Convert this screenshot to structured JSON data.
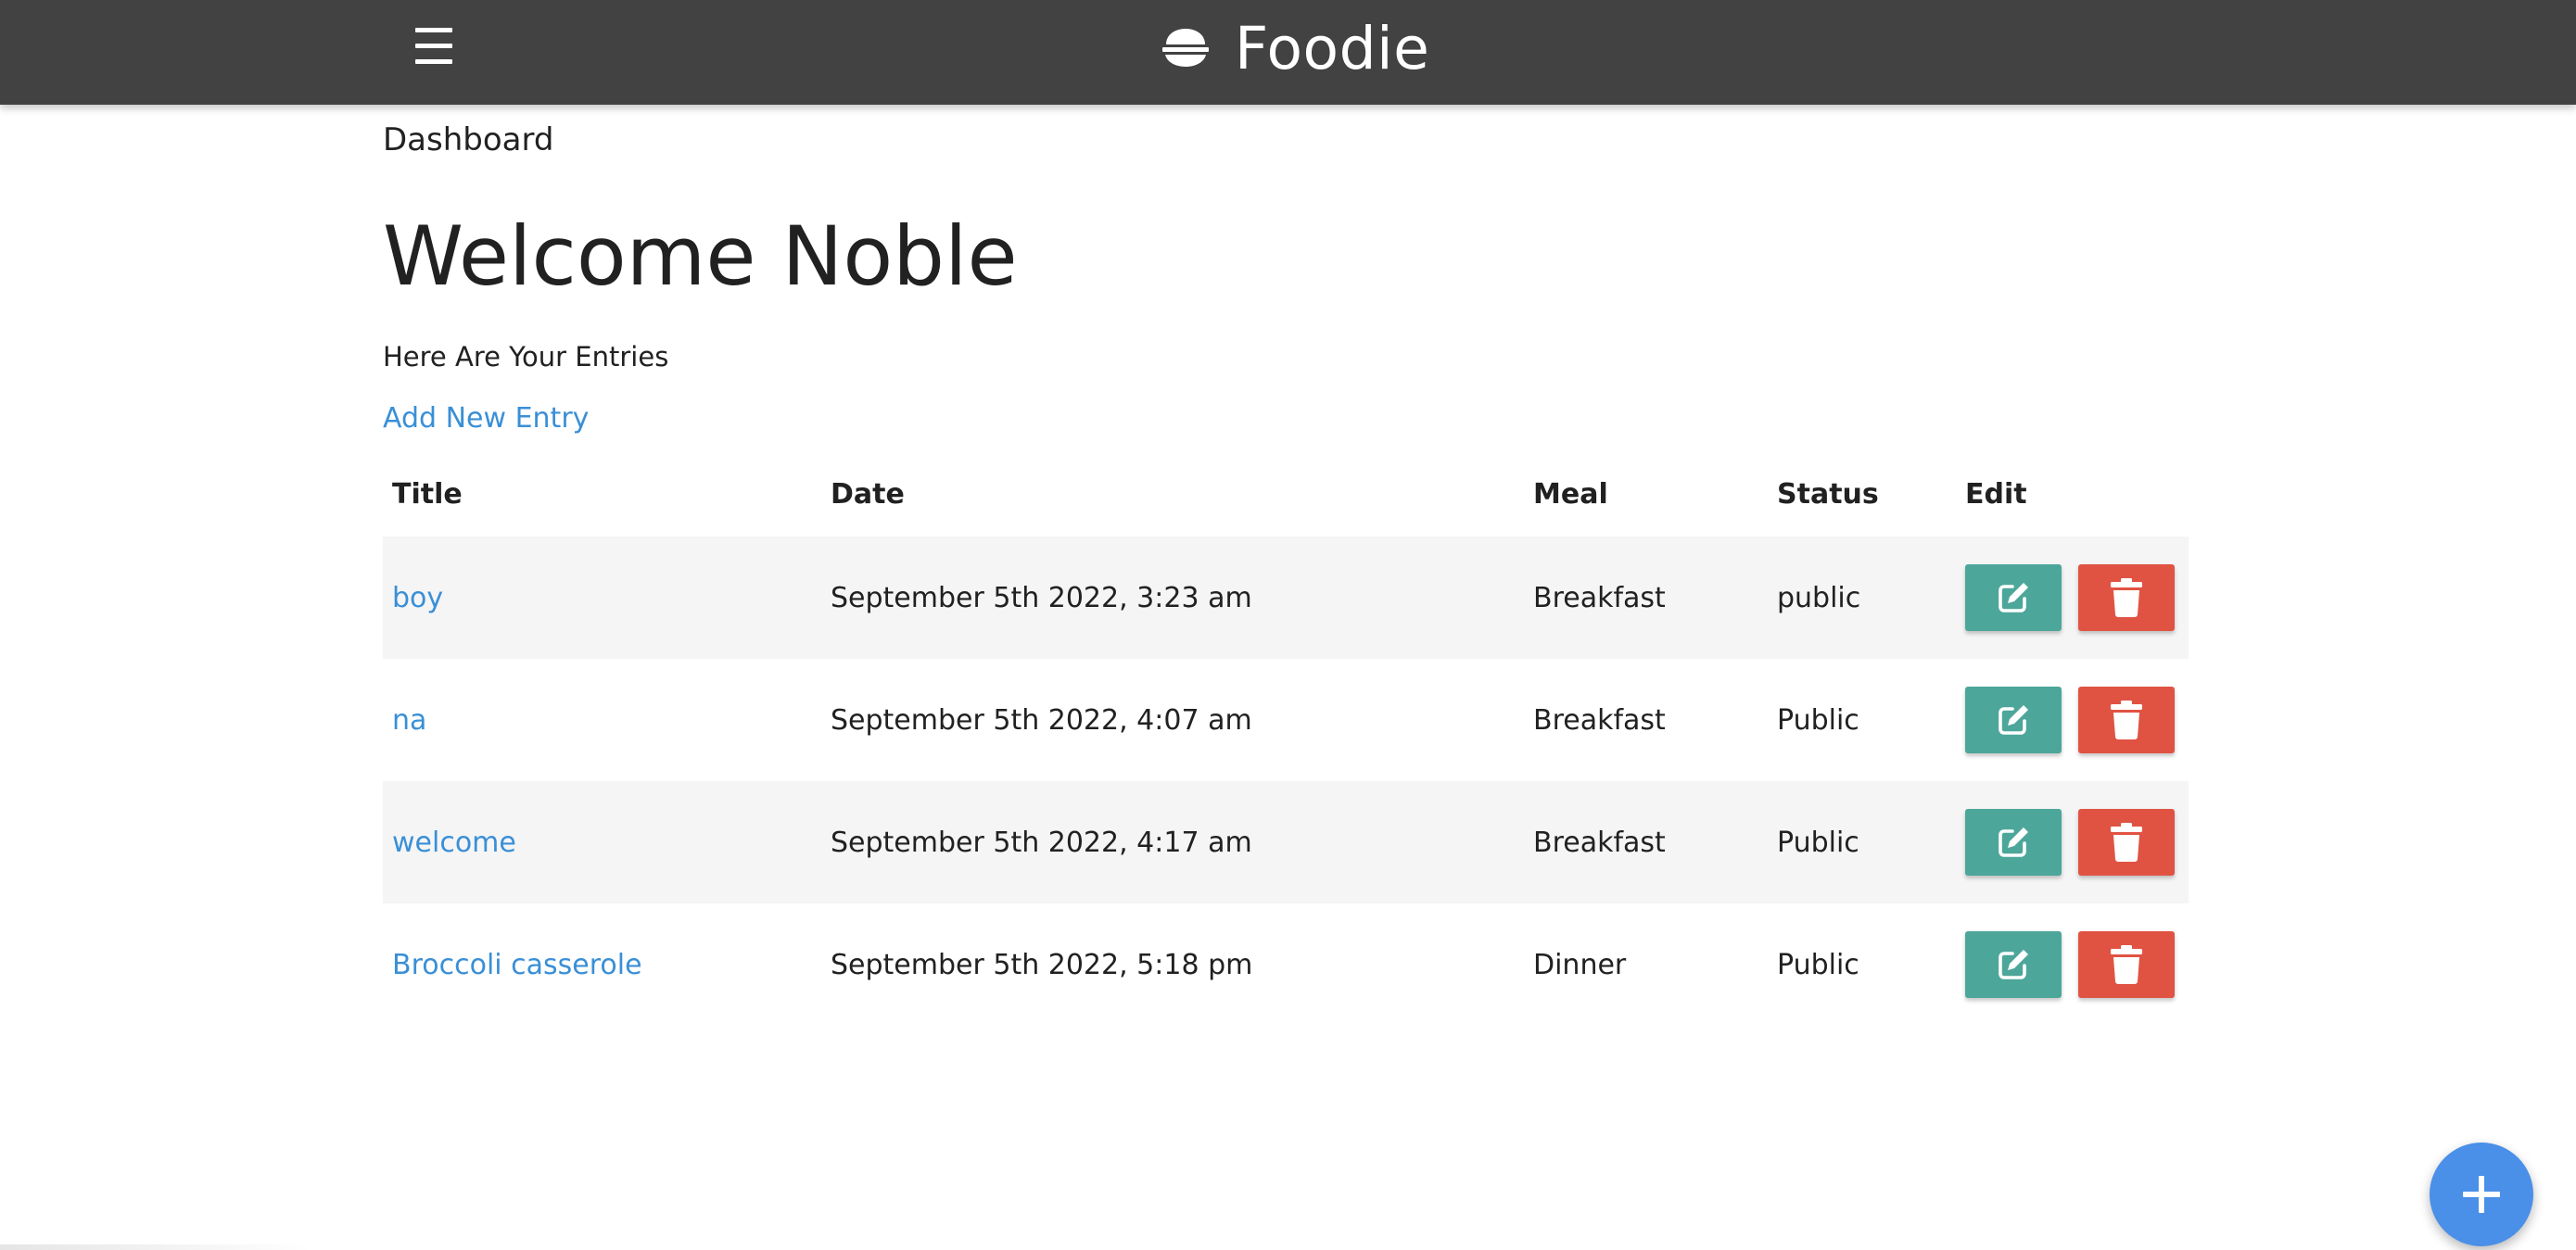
{
  "app": {
    "brand": "Foodie",
    "icon": "bowl-rice-icon"
  },
  "navbar": {
    "menu_icon": "hamburger-menu-icon"
  },
  "breadcrumb": "Dashboard",
  "page": {
    "title": "Welcome Noble",
    "subtitle": "Here Are Your Entries",
    "add_link": "Add New Entry"
  },
  "table": {
    "headers": {
      "title": "Title",
      "date": "Date",
      "meal": "Meal",
      "status": "Status",
      "edit": "Edit"
    },
    "rows": [
      {
        "title": "boy",
        "date": "September 5th 2022, 3:23 am",
        "meal": "Breakfast",
        "status": "public"
      },
      {
        "title": "na",
        "date": "September 5th 2022, 4:07 am",
        "meal": "Breakfast",
        "status": "Public"
      },
      {
        "title": "welcome",
        "date": "September 5th 2022, 4:17 am",
        "meal": "Breakfast",
        "status": "Public"
      },
      {
        "title": "Broccoli casserole",
        "date": "September 5th 2022, 5:18 pm",
        "meal": "Dinner",
        "status": "Public"
      }
    ],
    "edit_icon": "pen-to-square-icon",
    "delete_icon": "trash-icon"
  },
  "fab": {
    "icon": "plus-icon"
  },
  "colors": {
    "navbar": "#424242",
    "link": "#3a8fd6",
    "edit_button": "#4da69a",
    "delete_button": "#e05343",
    "fab": "#4a8fe8",
    "row_stripe": "#f5f5f5"
  }
}
